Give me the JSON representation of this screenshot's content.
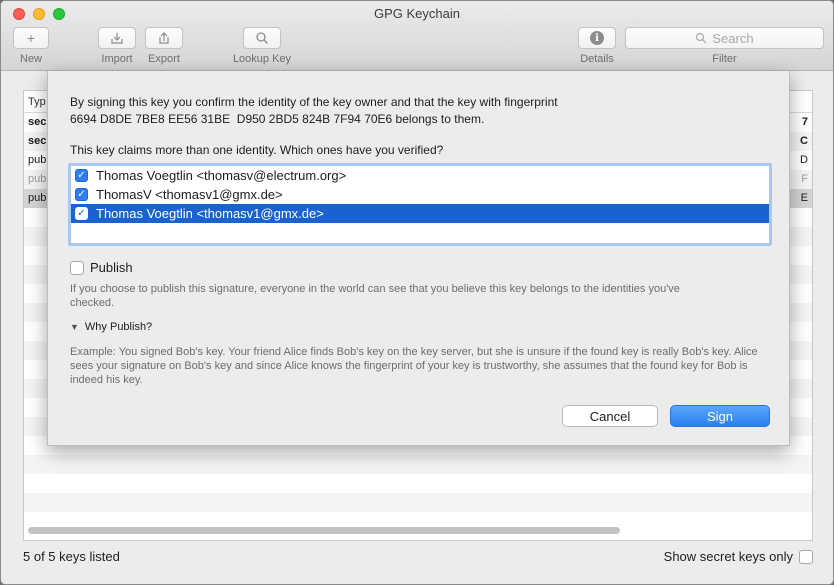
{
  "window": {
    "title": "GPG Keychain"
  },
  "toolbar": {
    "new_label": "New",
    "import_label": "Import",
    "export_label": "Export",
    "lookup_label": "Lookup Key",
    "details_label": "Details",
    "filter_label": "Filter",
    "search_placeholder": "Search",
    "new_icon": "+",
    "details_icon": "i"
  },
  "table": {
    "type_header": "Typ",
    "rows": [
      {
        "type": "sec",
        "end": "7",
        "bold": true
      },
      {
        "type": "sec",
        "end": "C",
        "bold": true
      },
      {
        "type": "pub",
        "end": "D",
        "bold": false
      },
      {
        "type": "pub",
        "end": "F",
        "bold": false
      },
      {
        "type": "pub",
        "end": "E",
        "bold": false
      }
    ]
  },
  "footer": {
    "count": "5 of 5 keys listed",
    "secret_only": "Show secret keys only"
  },
  "sheet": {
    "intro_line1": "By signing this key you confirm the identity of the key owner and that the key with fingerprint",
    "intro_line2": "6694 D8DE 7BE8 EE56 31BE  D950 2BD5 824B 7F94 70E6 belongs to them.",
    "claim": "This key claims more than one identity. Which ones have you verified?",
    "identities": [
      {
        "label": "Thomas Voegtlin <thomasv@electrum.org>",
        "checked": true
      },
      {
        "label": "ThomasV <thomasv1@gmx.de>",
        "checked": true
      },
      {
        "label": "Thomas Voegtlin <thomasv1@gmx.de>",
        "checked": true
      }
    ],
    "publish_label": "Publish",
    "publish_note": "If you choose to publish this signature, everyone in the world can see that you believe this key belongs to the identities you've checked.",
    "why_label": "Why Publish?",
    "example": "Example: You signed Bob's key. Your friend Alice finds Bob's key on the key server, but she is unsure if the found key is really Bob's key. Alice sees your signature on Bob's key and since Alice knows the fingerprint of your key is trustworthy, she assumes that the found key for Bob is indeed his key.",
    "cancel_label": "Cancel",
    "sign_label": "Sign"
  },
  "colors": {
    "accent": "#2b7ff0",
    "selection": "#1a62cf"
  }
}
